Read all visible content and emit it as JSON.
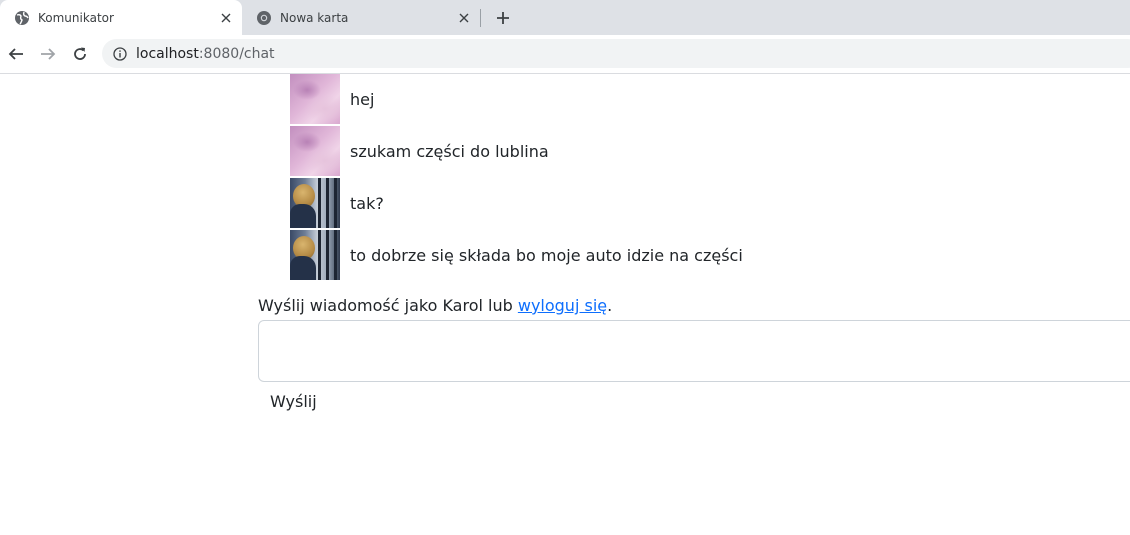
{
  "browser": {
    "tabs": [
      {
        "title": "Komunikator",
        "icon": "globe-icon",
        "active": true
      },
      {
        "title": "Nowa karta",
        "icon": "chrome-icon",
        "active": false
      }
    ],
    "url_host": "localhost",
    "url_rest": ":8080/chat"
  },
  "chat": {
    "messages": [
      {
        "avatar": "pink-avatar",
        "text": "hej"
      },
      {
        "avatar": "pink-avatar",
        "text": "szukam części do lublina"
      },
      {
        "avatar": "photo-avatar",
        "text": "tak?"
      },
      {
        "avatar": "photo-avatar",
        "text": "to dobrze się składa bo moje auto idzie na części"
      }
    ]
  },
  "compose": {
    "prefix": "Wyślij wiadomość jako Karol lub ",
    "logout_link": "wyloguj się",
    "suffix": ".",
    "input_value": "",
    "send_label": "Wyślij"
  },
  "colors": {
    "link": "#0d6efd",
    "text": "#212529",
    "tabbar": "#dee1e6"
  }
}
